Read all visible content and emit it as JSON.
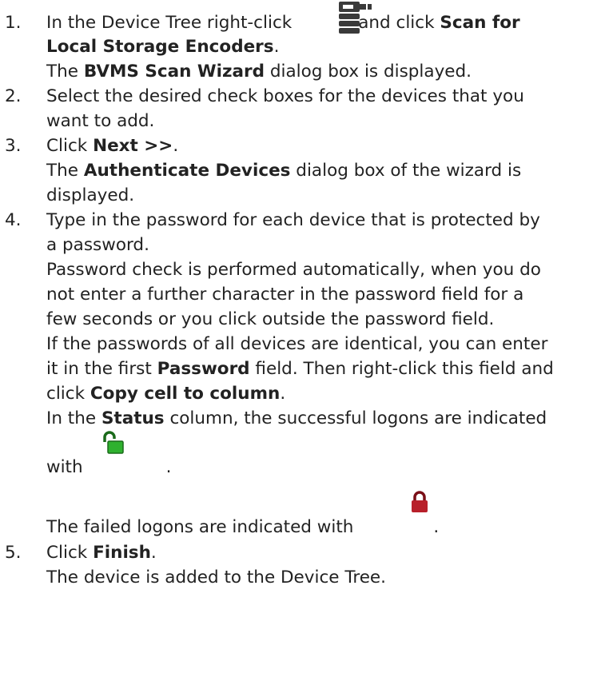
{
  "steps": [
    {
      "number": "1.",
      "lines": [
        [
          "In the Device Tree right-click",
          "and click",
          "Scan for"
        ],
        [
          "Local Storage Encoders",
          "."
        ],
        [
          "The",
          "BVMS Scan Wizard",
          "dialog box is displayed."
        ]
      ]
    },
    {
      "number": "2.",
      "lines": [
        [
          "Select the desired check boxes for the devices that you"
        ],
        [
          "want to add."
        ]
      ]
    },
    {
      "number": "3.",
      "lines": [
        [
          "Click",
          "Next >>",
          "."
        ],
        [
          "The",
          "Authenticate Devices",
          "dialog box of the wizard is"
        ],
        [
          "displayed."
        ]
      ]
    },
    {
      "number": "4.",
      "lines": [
        [
          "Type in the password for each device that is protected by"
        ],
        [
          "a password."
        ],
        [
          "Password check is performed automatically, when you do"
        ],
        [
          "not enter a further character in the password field for a"
        ],
        [
          "few seconds or you click outside the password field."
        ],
        [
          "If the passwords of all devices are identical, you can enter"
        ],
        [
          "it in the first",
          "Password",
          "field. Then right-click this field and"
        ],
        [
          "click",
          "Copy cell to column",
          "."
        ],
        [
          "In the",
          "Status",
          "column, the successful logons are indicated"
        ],
        [
          "with",
          "."
        ],
        [
          "The failed logons are indicated with",
          "."
        ]
      ]
    },
    {
      "number": "5.",
      "lines": [
        [
          "Click",
          "Finish",
          "."
        ],
        [
          "The device is added to the Device Tree."
        ]
      ]
    }
  ],
  "icons": {
    "storage_encoder": "storage-encoder-icon",
    "logon_success": "unlocked-padlock-icon",
    "logon_failed": "locked-padlock-icon"
  },
  "colors": {
    "text": "#222222",
    "success_green": "#2fb12f",
    "failed_red": "#b8202a",
    "device_dark": "#3a3a3a"
  }
}
